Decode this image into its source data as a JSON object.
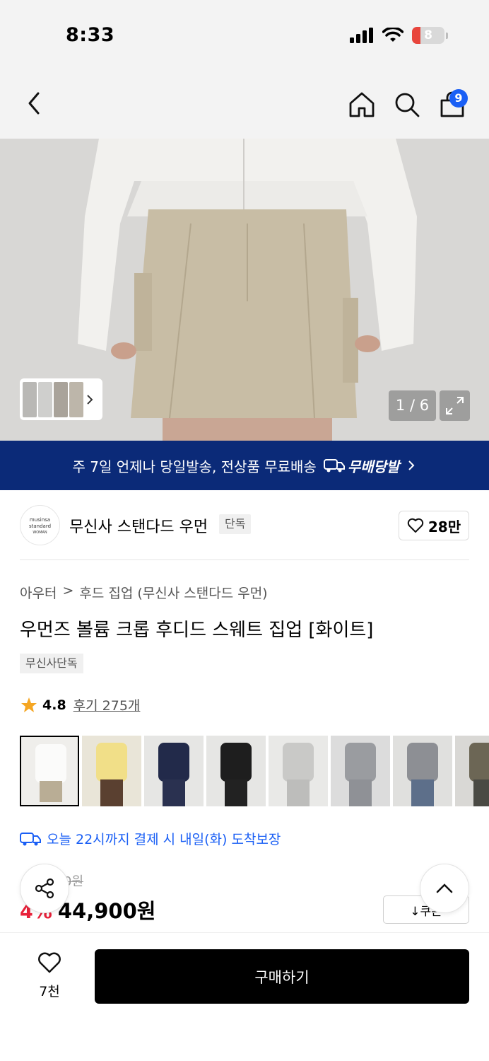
{
  "status": {
    "time": "8:33",
    "battery": "8"
  },
  "nav": {
    "cart_count": "9"
  },
  "gallery": {
    "counter": "1 / 6"
  },
  "banner": {
    "text": "주 7일 언제나 당일발송, 전상품 무료배송",
    "brand": "무배당발"
  },
  "brand": {
    "logo_line1": "musinsa",
    "logo_line2": "standard",
    "logo_line3": "WOMAN",
    "name": "무신사 스탠다드 우먼",
    "tag": "단독",
    "likes": "28만"
  },
  "breadcrumb": {
    "category": "아우터",
    "separator": ">",
    "subcategory": "후드 집업 (무신사 스탠다드 우먼)"
  },
  "product": {
    "title": "우먼즈 볼륨 크롭 후디드 스웨트 집업 [화이트]",
    "tag": "무신사단독"
  },
  "rating": {
    "score": "4.8",
    "reviews": "후기 275개"
  },
  "delivery": {
    "text": "오늘 22시까지 결제 시 내일(화) 도착보장"
  },
  "price": {
    "original": "0원",
    "discount": "4%",
    "current": "44,900원",
    "coupon_label": "↓쿠폰"
  },
  "bottom": {
    "wish_count": "7천",
    "buy_label": "구매하기"
  },
  "colors": {
    "accent": "#1a5ff5",
    "banner": "#0b2a78",
    "discount": "#e8213a"
  }
}
